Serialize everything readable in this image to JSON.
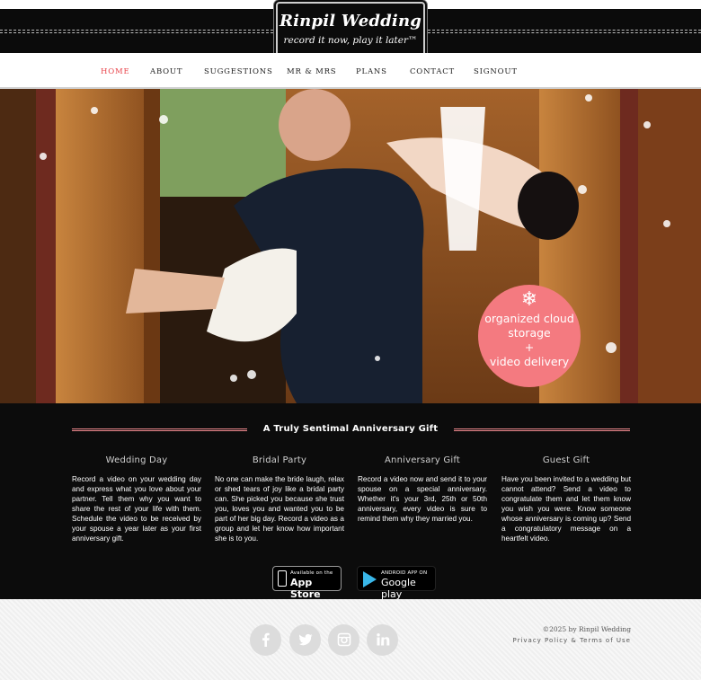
{
  "brand": {
    "name": "Rinpil Wedding",
    "tagline": "record it now, play it later™"
  },
  "nav": {
    "items": [
      {
        "label": "HOME",
        "active": true
      },
      {
        "label": "ABOUT"
      },
      {
        "label": "SUGGESTIONS"
      },
      {
        "label": "MR & MRS"
      },
      {
        "label": "PLANS"
      },
      {
        "label": "CONTACT"
      },
      {
        "label": "SIGNOUT"
      }
    ]
  },
  "hero": {
    "badge": {
      "icon": "snowflake-icon",
      "line1": "organized cloud",
      "line2": "storage",
      "line3": "+",
      "line4": "video delivery"
    }
  },
  "section": {
    "headline": "A Truly Sentimal Anniversary Gift",
    "columns": [
      {
        "title": "Wedding Day",
        "text": "Record a video on your wedding day and express what you love about your partner. Tell them why you want to share the rest of your life with them. Schedule the video to be received by your spouse a year later as your first anniversary gift."
      },
      {
        "title": "Bridal Party",
        "text": "No one can make the bride laugh, relax or shed tears of joy like a bridal party can. She picked you because she trust you, loves you and wanted you to be part of her big day. Record a video as a group and let her know how important she is to you."
      },
      {
        "title": "Anniversary Gift",
        "text": "Record a video now and send it to your spouse on a special anniversary. Whether it's your 3rd, 25th or 50th anniversary, every video is sure to remind them why they married you."
      },
      {
        "title": "Guest Gift",
        "text": "Have you been invited to a wedding but cannot attend? Send a video to congratulate them and let them know you wish you were. Know someone whose anniversary is coming up? Send a congratulatory message on a heartfelt video."
      }
    ],
    "stores": {
      "apple_small": "Available on the",
      "apple_big": "App Store",
      "google_small": "ANDROID APP ON",
      "google_big": "Google play"
    }
  },
  "footer": {
    "copyright": "©2025 by Rinpil Wedding",
    "links": "Privacy Policy & Terms of Use",
    "social": [
      "facebook-icon",
      "twitter-icon",
      "instagram-icon",
      "linkedin-icon"
    ]
  },
  "colors": {
    "accent": "#e8434a",
    "badge": "#f47a80",
    "dark": "#0c0c0c"
  }
}
